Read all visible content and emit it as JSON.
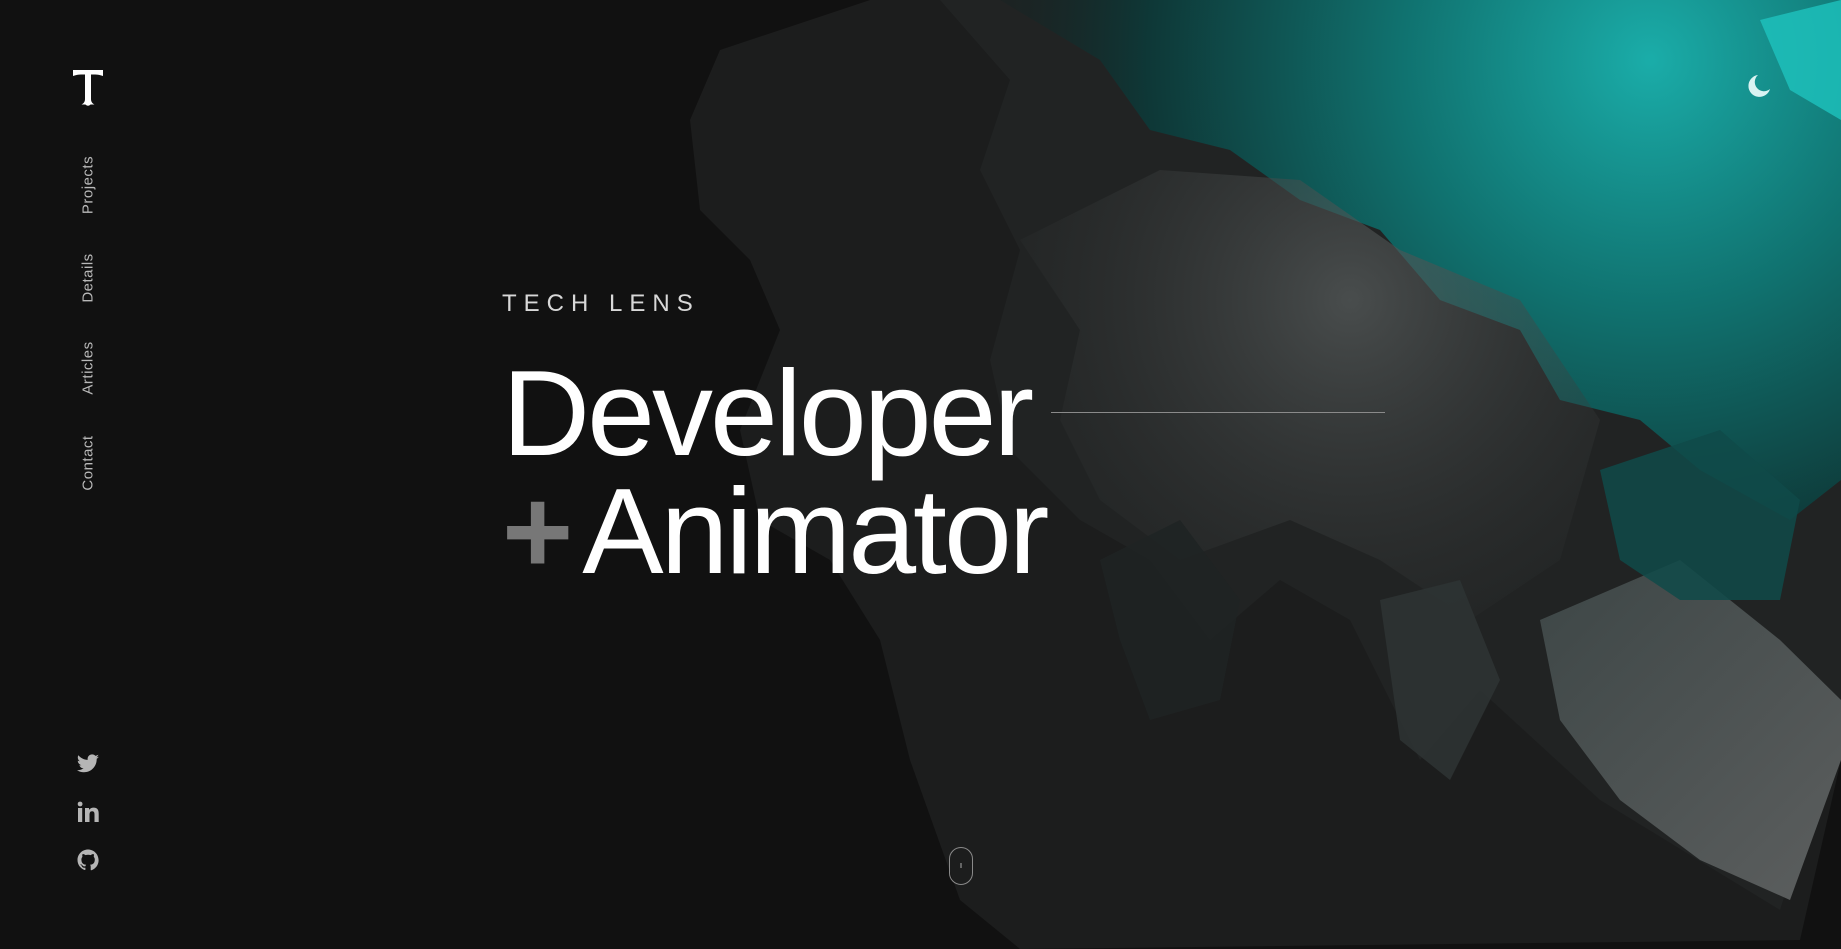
{
  "brand": {
    "logo_letter": "T"
  },
  "nav": {
    "items": [
      {
        "label": "Projects"
      },
      {
        "label": "Details"
      },
      {
        "label": "Articles"
      },
      {
        "label": "Contact"
      }
    ]
  },
  "hero": {
    "eyebrow": "TECH LENS",
    "line1": "Developer",
    "plus": "+",
    "line2": "Animator"
  },
  "socials": [
    {
      "icon": "twitter-icon"
    },
    {
      "icon": "linkedin-icon"
    },
    {
      "icon": "github-icon"
    }
  ],
  "theme_toggle": {
    "icon": "moon-icon"
  },
  "colors": {
    "background": "#111111",
    "accent": "#0fb3b3",
    "text": "#ffffff",
    "muted": "#777777"
  }
}
